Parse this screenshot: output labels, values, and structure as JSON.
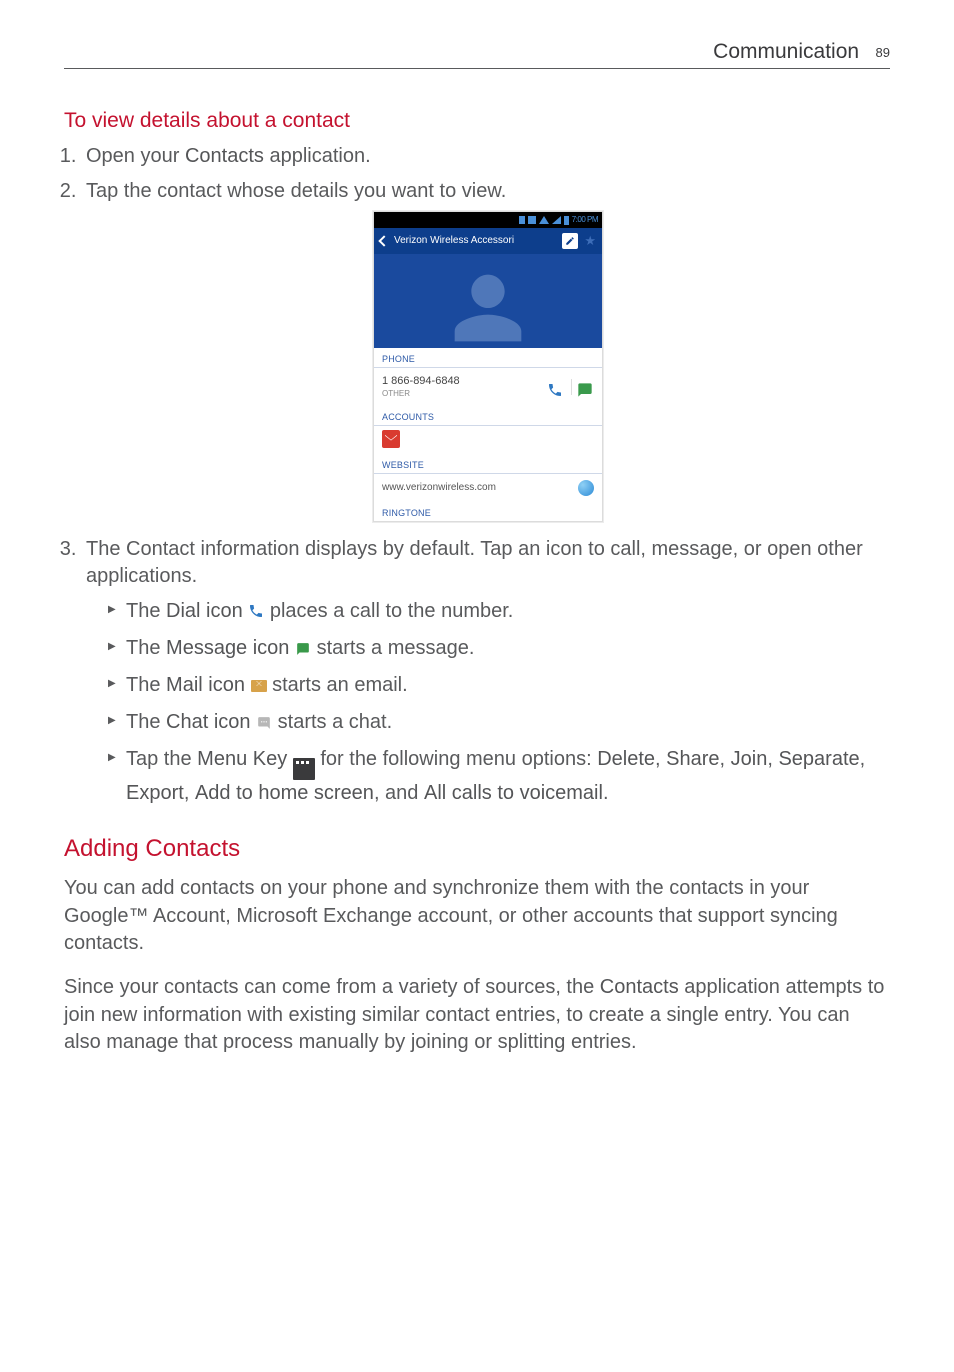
{
  "header": {
    "title": "Communication",
    "page_num": "89"
  },
  "section1": {
    "heading": "To view details about a contact",
    "step1_open": "Open your ",
    "step1_bold": "Contacts",
    "step1_rest": " application.",
    "step2": "Tap the contact whose details you want to view.",
    "step3_a": "The Contact information displays by default. Tap an icon to call, message, or open other applications.",
    "bullets": {
      "dial_a": "The ",
      "dial_b": "Dial icon",
      "dial_c": " places a call to the number.",
      "msg_a": "The ",
      "msg_b": "Message icon",
      "msg_c": " starts a message.",
      "mail_a": "The ",
      "mail_b": "Mail icon",
      "mail_c": " starts an email.",
      "chat_a": "The ",
      "chat_b": "Chat icon",
      "chat_c": " starts a chat.",
      "menu_a": "Tap the ",
      "menu_b": "Menu Key",
      "menu_c": " for the following menu options: ",
      "menu_opts1": "Delete",
      "menu_sep1": ", ",
      "menu_opts2": "Share",
      "menu_sep2": ", ",
      "menu_opts3": "Join",
      "menu_sep3": ", ",
      "menu_opts4": "Separate",
      "menu_sep4": ", ",
      "menu_opts5": "Export",
      "menu_sep5": ", ",
      "menu_opts6": "Add to home screen",
      "menu_sep6": ", and ",
      "menu_opts7": "All calls to voicemail",
      "menu_end": "."
    }
  },
  "screenshot": {
    "time": "7:00 PM",
    "contact_name": "Verizon Wireless Accessori",
    "labels": {
      "phone": "PHONE",
      "accounts": "ACCOUNTS",
      "website": "WEBSITE",
      "ringtone": "RINGTONE"
    },
    "phone_number": "1 866-894-6848",
    "phone_type": "OTHER",
    "website": "www.verizonwireless.com"
  },
  "section2": {
    "heading": "Adding Contacts",
    "p1": "You can add contacts on your phone and synchronize them with the contacts in your Google™ Account, Microsoft Exchange account, or other accounts that support syncing contacts.",
    "p2a": "Since your contacts can come from a variety of sources, the ",
    "p2b": "Contacts",
    "p2c": " application attempts to join new information with existing similar contact entries, to create a single entry. You can also manage that process manually by joining or splitting entries."
  }
}
